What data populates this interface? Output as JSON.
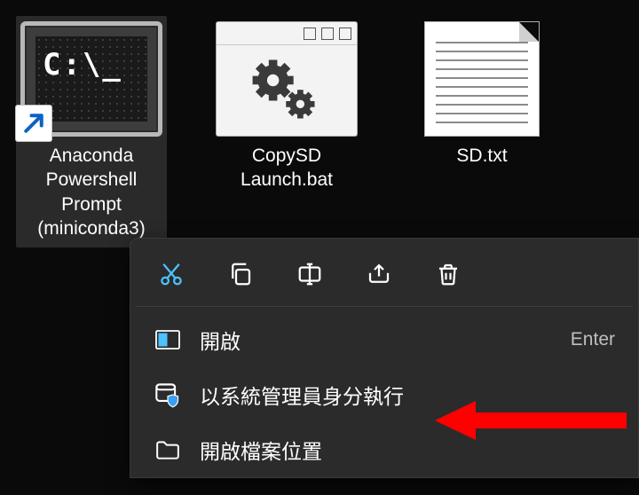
{
  "files": [
    {
      "id": "anaconda",
      "label": "Anaconda\nPowershell\nPrompt\n(miniconda3)",
      "selected": true,
      "kind": "terminal-shortcut"
    },
    {
      "id": "copysd",
      "label": "CopySD\nLaunch.bat",
      "selected": false,
      "kind": "bat"
    },
    {
      "id": "sdtxt",
      "label": "SD.txt",
      "selected": false,
      "kind": "txt"
    }
  ],
  "terminal_prompt_glyph": "C:\\_",
  "toolbar_names": [
    "cut",
    "copy",
    "rename",
    "share",
    "delete"
  ],
  "context_menu": {
    "open": {
      "label": "開啟",
      "shortcut": "Enter"
    },
    "run_admin": {
      "label": "以系統管理員身分執行"
    },
    "open_location": {
      "label": "開啟檔案位置"
    }
  },
  "colors": {
    "cut_accent": "#4cc2ff",
    "icon_stroke": "#ffffff",
    "admin_shield": "#3a9ff5",
    "arrow": "#ff0000"
  }
}
